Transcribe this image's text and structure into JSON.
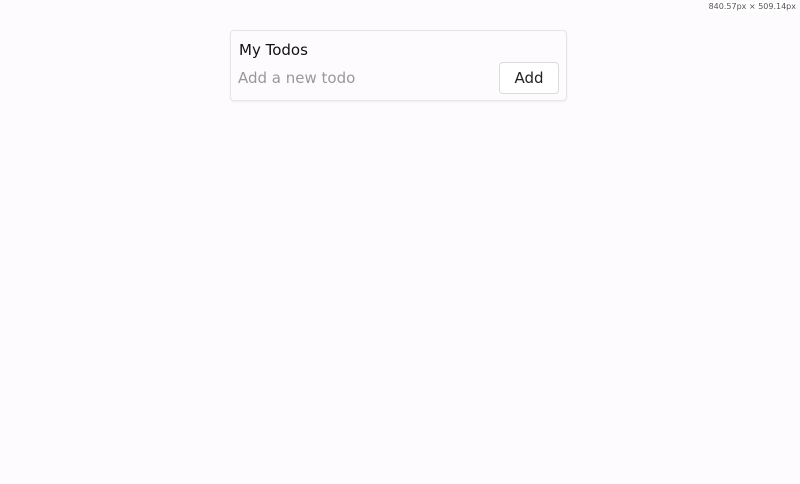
{
  "viewport_readout": "840.57px × 509.14px",
  "todo": {
    "title": "My Todos",
    "input_value": "",
    "input_placeholder": "Add a new todo",
    "add_label": "Add"
  }
}
